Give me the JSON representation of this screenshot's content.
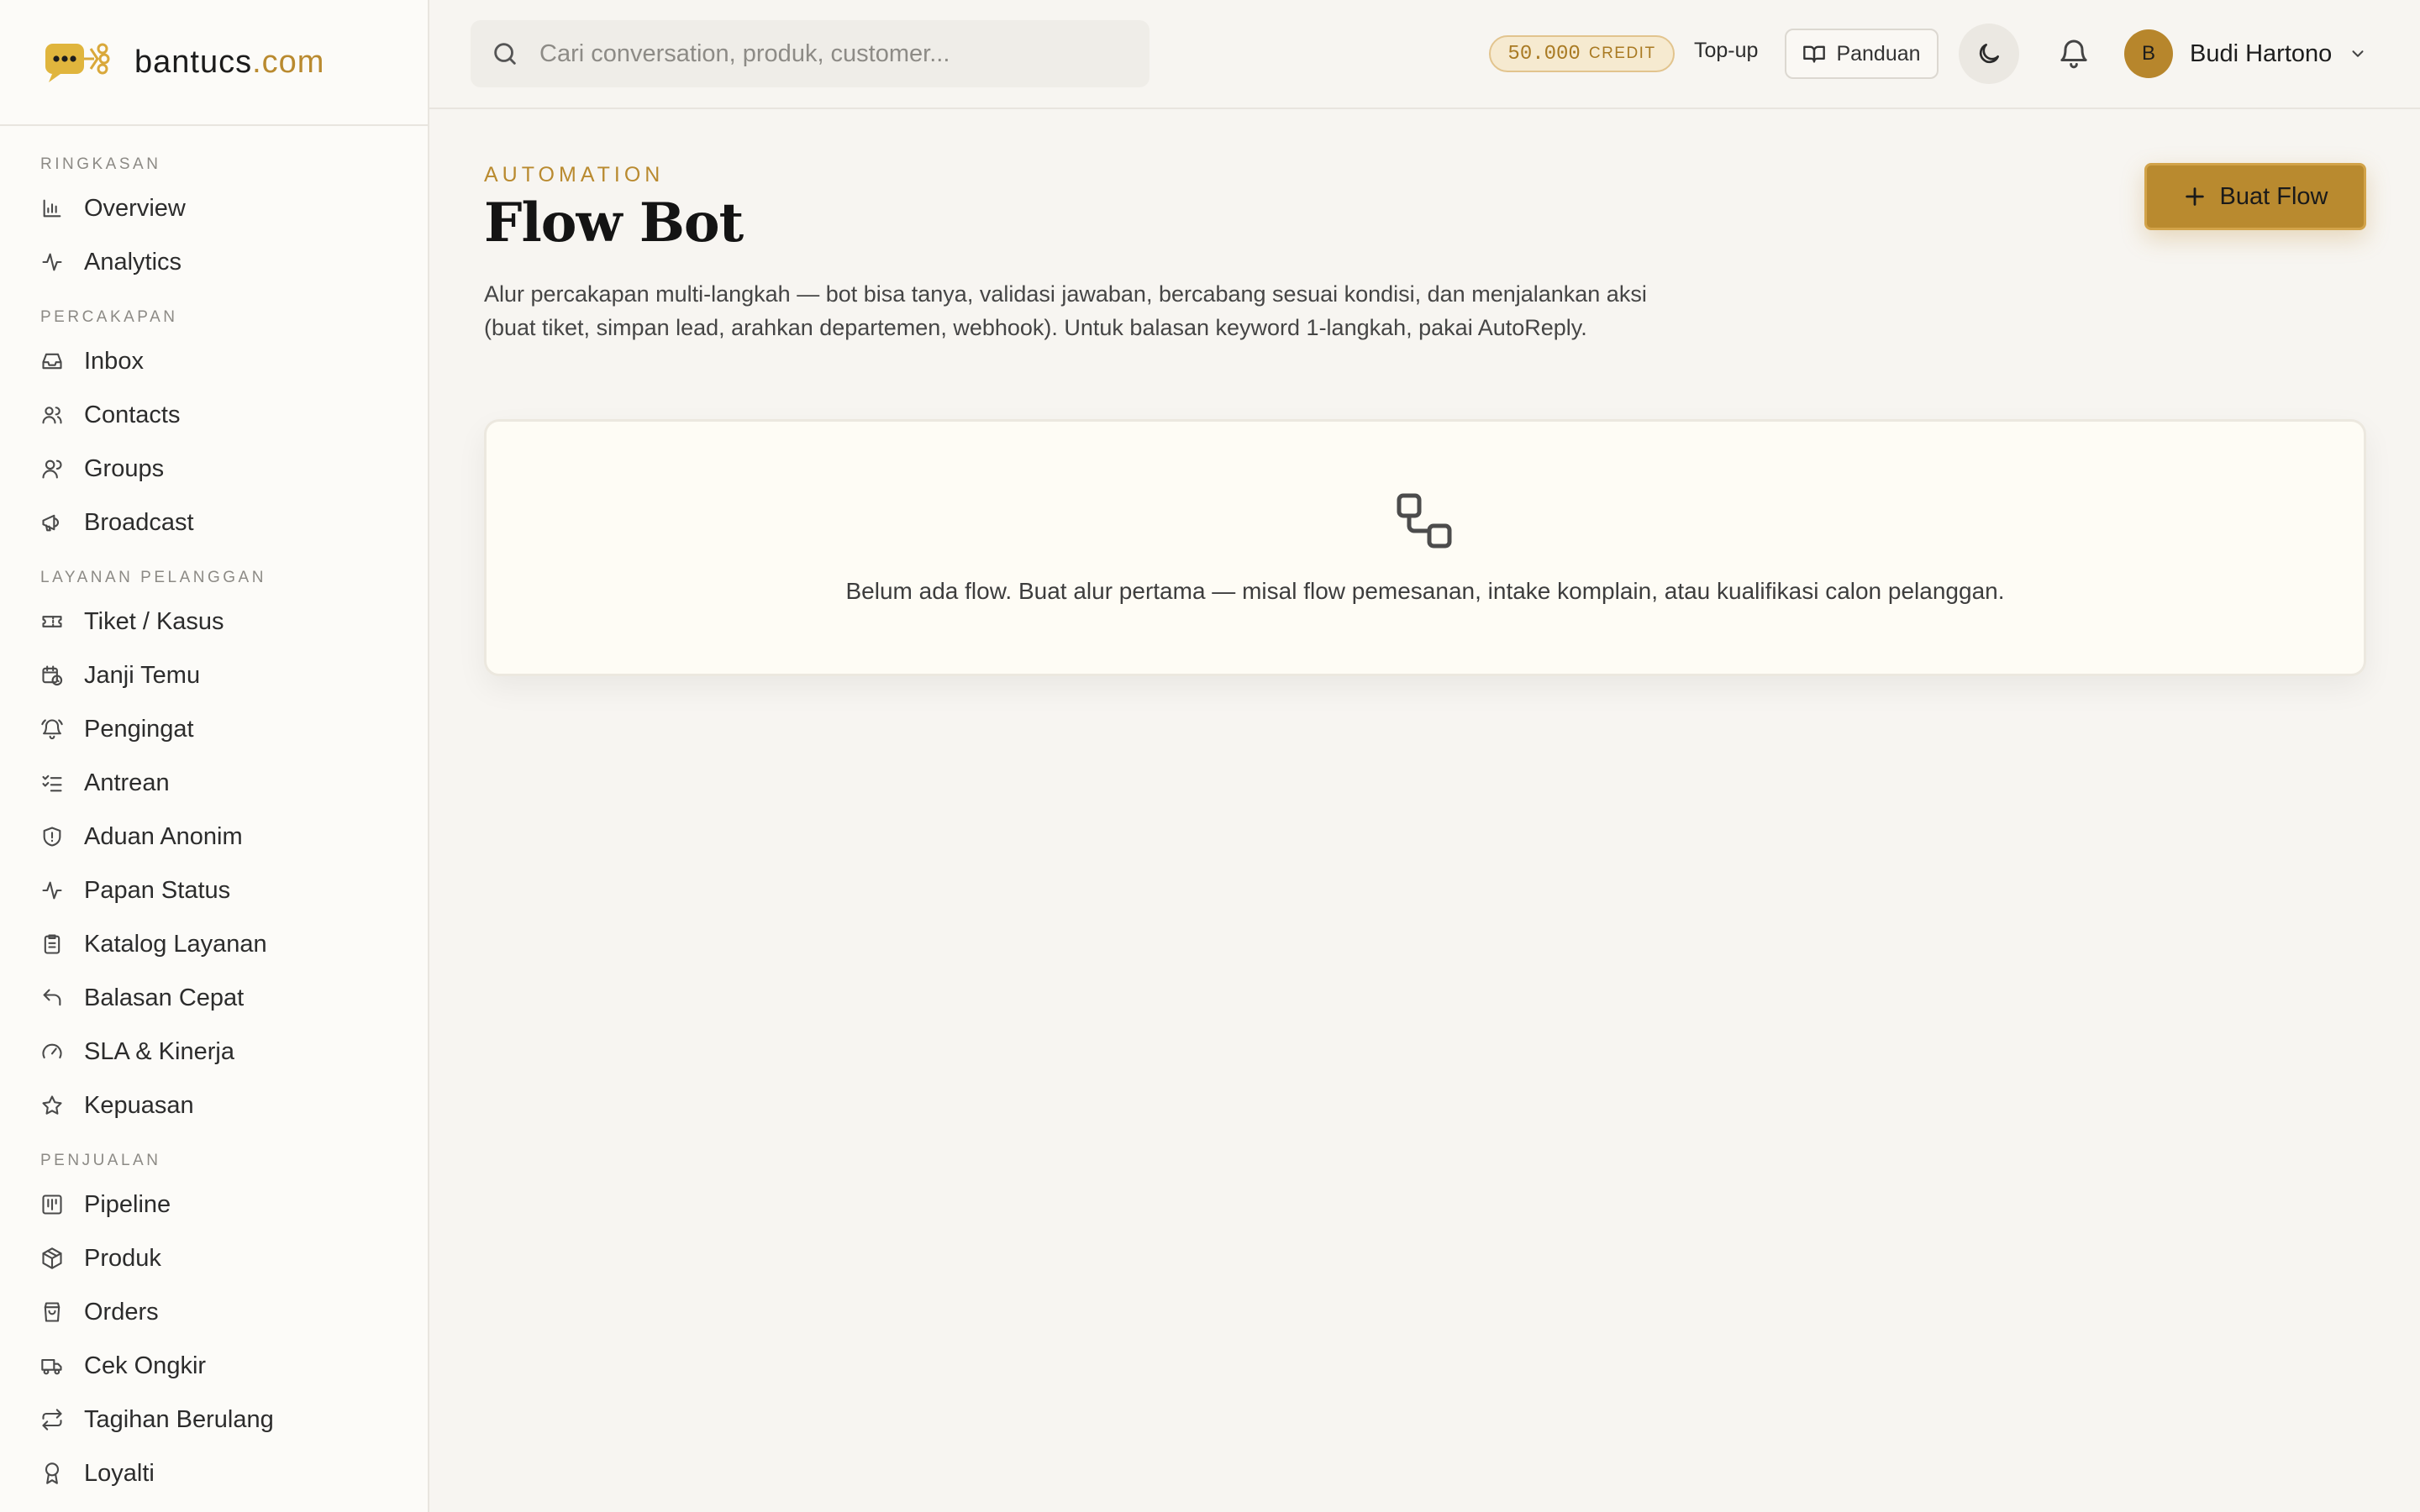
{
  "brand": {
    "name": "bantucs",
    "tld": ".com"
  },
  "sidebar": {
    "sections": [
      {
        "title": "RINGKASAN",
        "items": [
          {
            "label": "Overview",
            "icon": "bar-chart-icon"
          },
          {
            "label": "Analytics",
            "icon": "activity-icon"
          }
        ]
      },
      {
        "title": "PERCAKAPAN",
        "items": [
          {
            "label": "Inbox",
            "icon": "inbox-icon"
          },
          {
            "label": "Contacts",
            "icon": "users-icon"
          },
          {
            "label": "Groups",
            "icon": "user-group-icon"
          },
          {
            "label": "Broadcast",
            "icon": "megaphone-icon"
          }
        ]
      },
      {
        "title": "LAYANAN PELANGGAN",
        "items": [
          {
            "label": "Tiket / Kasus",
            "icon": "ticket-icon"
          },
          {
            "label": "Janji Temu",
            "icon": "calendar-clock-icon"
          },
          {
            "label": "Pengingat",
            "icon": "bell-ring-icon"
          },
          {
            "label": "Antrean",
            "icon": "list-checks-icon"
          },
          {
            "label": "Aduan Anonim",
            "icon": "shield-alert-icon"
          },
          {
            "label": "Papan Status",
            "icon": "activity-icon"
          },
          {
            "label": "Katalog Layanan",
            "icon": "clipboard-list-icon"
          },
          {
            "label": "Balasan Cepat",
            "icon": "reply-icon"
          },
          {
            "label": "SLA & Kinerja",
            "icon": "gauge-icon"
          },
          {
            "label": "Kepuasan",
            "icon": "star-icon"
          }
        ]
      },
      {
        "title": "PENJUALAN",
        "items": [
          {
            "label": "Pipeline",
            "icon": "kanban-icon"
          },
          {
            "label": "Produk",
            "icon": "package-icon"
          },
          {
            "label": "Orders",
            "icon": "shopping-bag-icon"
          },
          {
            "label": "Cek Ongkir",
            "icon": "truck-icon"
          },
          {
            "label": "Tagihan Berulang",
            "icon": "repeat-icon"
          },
          {
            "label": "Loyalti",
            "icon": "award-icon"
          }
        ]
      }
    ]
  },
  "topbar": {
    "search_placeholder": "Cari conversation, produk, customer...",
    "credit_amount": "50.000",
    "credit_label": "CREDIT",
    "topup_label": "Top-up",
    "guide_label": "Panduan",
    "user_initial": "B",
    "user_name": "Budi Hartono"
  },
  "page": {
    "eyebrow": "AUTOMATION",
    "title": "Flow Bot",
    "description": "Alur percakapan multi-langkah — bot bisa tanya, validasi jawaban, bercabang sesuai kondisi, dan menjalankan aksi (buat tiket, simpan lead, arahkan departemen, webhook). Untuk balasan keyword 1-langkah, pakai AutoReply.",
    "primary_button": "Buat Flow",
    "empty_state": "Belum ada flow. Buat alur pertama — misal flow pemesanan, intake komplain, atau kualifikasi calon pelanggan."
  },
  "colors": {
    "accent": "#b98a2f",
    "background": "#f7f5f1",
    "sidebar": "#fcfbf8",
    "card": "#fefcf5"
  }
}
